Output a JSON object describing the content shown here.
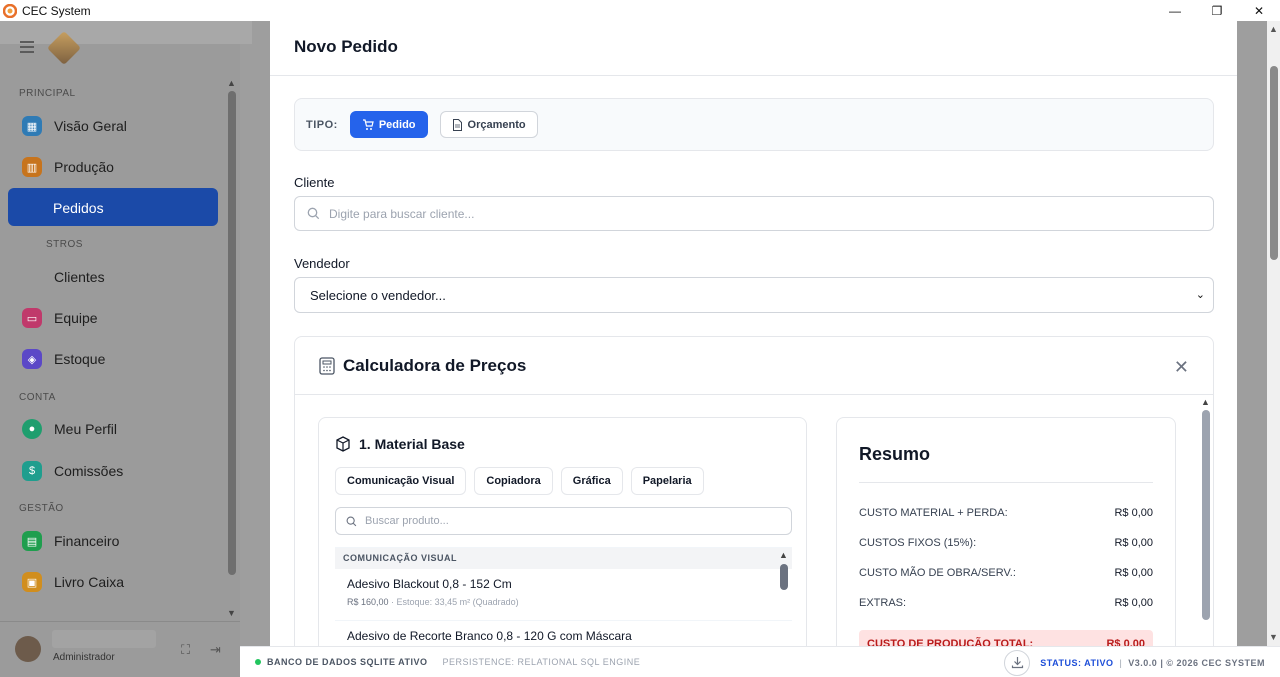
{
  "window": {
    "title": "CEC System",
    "controls": [
      "—",
      "❐",
      "✕"
    ]
  },
  "sidebar": {
    "sections": {
      "principal": "PRINCIPAL",
      "cadastros": "STROS",
      "conta": "CONTA",
      "gestao": "GESTÃO"
    },
    "items": [
      {
        "label": "Visão Geral",
        "icon": "grid-icon",
        "color": "#2f7bb5"
      },
      {
        "label": "Produção",
        "icon": "factory-icon",
        "color": "#c7741d"
      },
      {
        "label": "Pedidos",
        "icon": "cart-icon",
        "color": "#1b4aa8"
      },
      {
        "label": "Clientes",
        "icon": "users-icon",
        "color": "#9b9b9b"
      },
      {
        "label": "Equipe",
        "icon": "briefcase-icon",
        "color": "#c0396b"
      },
      {
        "label": "Estoque",
        "icon": "box-icon",
        "color": "#5b48c7"
      },
      {
        "label": "Meu Perfil",
        "icon": "user-icon",
        "color": "#1f9e6e"
      },
      {
        "label": "Comissões",
        "icon": "dollar-icon",
        "color": "#1f9e8e"
      },
      {
        "label": "Financeiro",
        "icon": "sheet-icon",
        "color": "#1f9e4e"
      },
      {
        "label": "Livro Caixa",
        "icon": "wallet-icon",
        "color": "#d18e1e"
      }
    ],
    "user_role": "Administrador"
  },
  "modal": {
    "title": "Novo Pedido",
    "tipo": {
      "label": "TIPO:",
      "options": [
        "Pedido",
        "Orçamento"
      ],
      "selected": "Pedido"
    },
    "cliente": {
      "label": "Cliente",
      "placeholder": "Digite para buscar cliente..."
    },
    "vendedor": {
      "label": "Vendedor",
      "value": "Selecione o vendedor..."
    },
    "calculadora": {
      "title": "Calculadora de Preços",
      "material": {
        "title": "1. Material Base",
        "categories": [
          "Comunicação Visual",
          "Copiadora",
          "Gráfica",
          "Papelaria"
        ],
        "search_placeholder": "Buscar produto...",
        "group": "COMUNICAÇÃO VISUAL",
        "products": [
          {
            "name": "Adesivo Blackout 0,8 - 152 Cm",
            "price": "R$ 160,00",
            "detail": " · Estoque: 33,45 m² (Quadrado)"
          },
          {
            "name": "Adesivo de Recorte Branco 0,8 - 120 G com Máscara",
            "price": "",
            "detail": ""
          }
        ]
      },
      "resumo": {
        "title": "Resumo",
        "rows": [
          {
            "label": "CUSTO MATERIAL + PERDA:",
            "value": "R$ 0,00"
          },
          {
            "label": "CUSTOS FIXOS (15%):",
            "value": "R$ 0,00"
          },
          {
            "label": "CUSTO MÃO DE OBRA/SERV.:",
            "value": "R$ 0,00"
          },
          {
            "label": "EXTRAS:",
            "value": "R$ 0,00"
          }
        ],
        "total": {
          "label": "CUSTO DE PRODUÇÃO TOTAL:",
          "value": "R$ 0,00"
        }
      }
    }
  },
  "statusbar": {
    "db": "BANCO DE DADOS SQLITE ATIVO",
    "persistence": "PERSISTENCE: RELATIONAL SQL ENGINE",
    "status": "STATUS: ATIVO",
    "sep": "|",
    "version": "V3.0.0 | © 2026 CEC SYSTEM"
  }
}
